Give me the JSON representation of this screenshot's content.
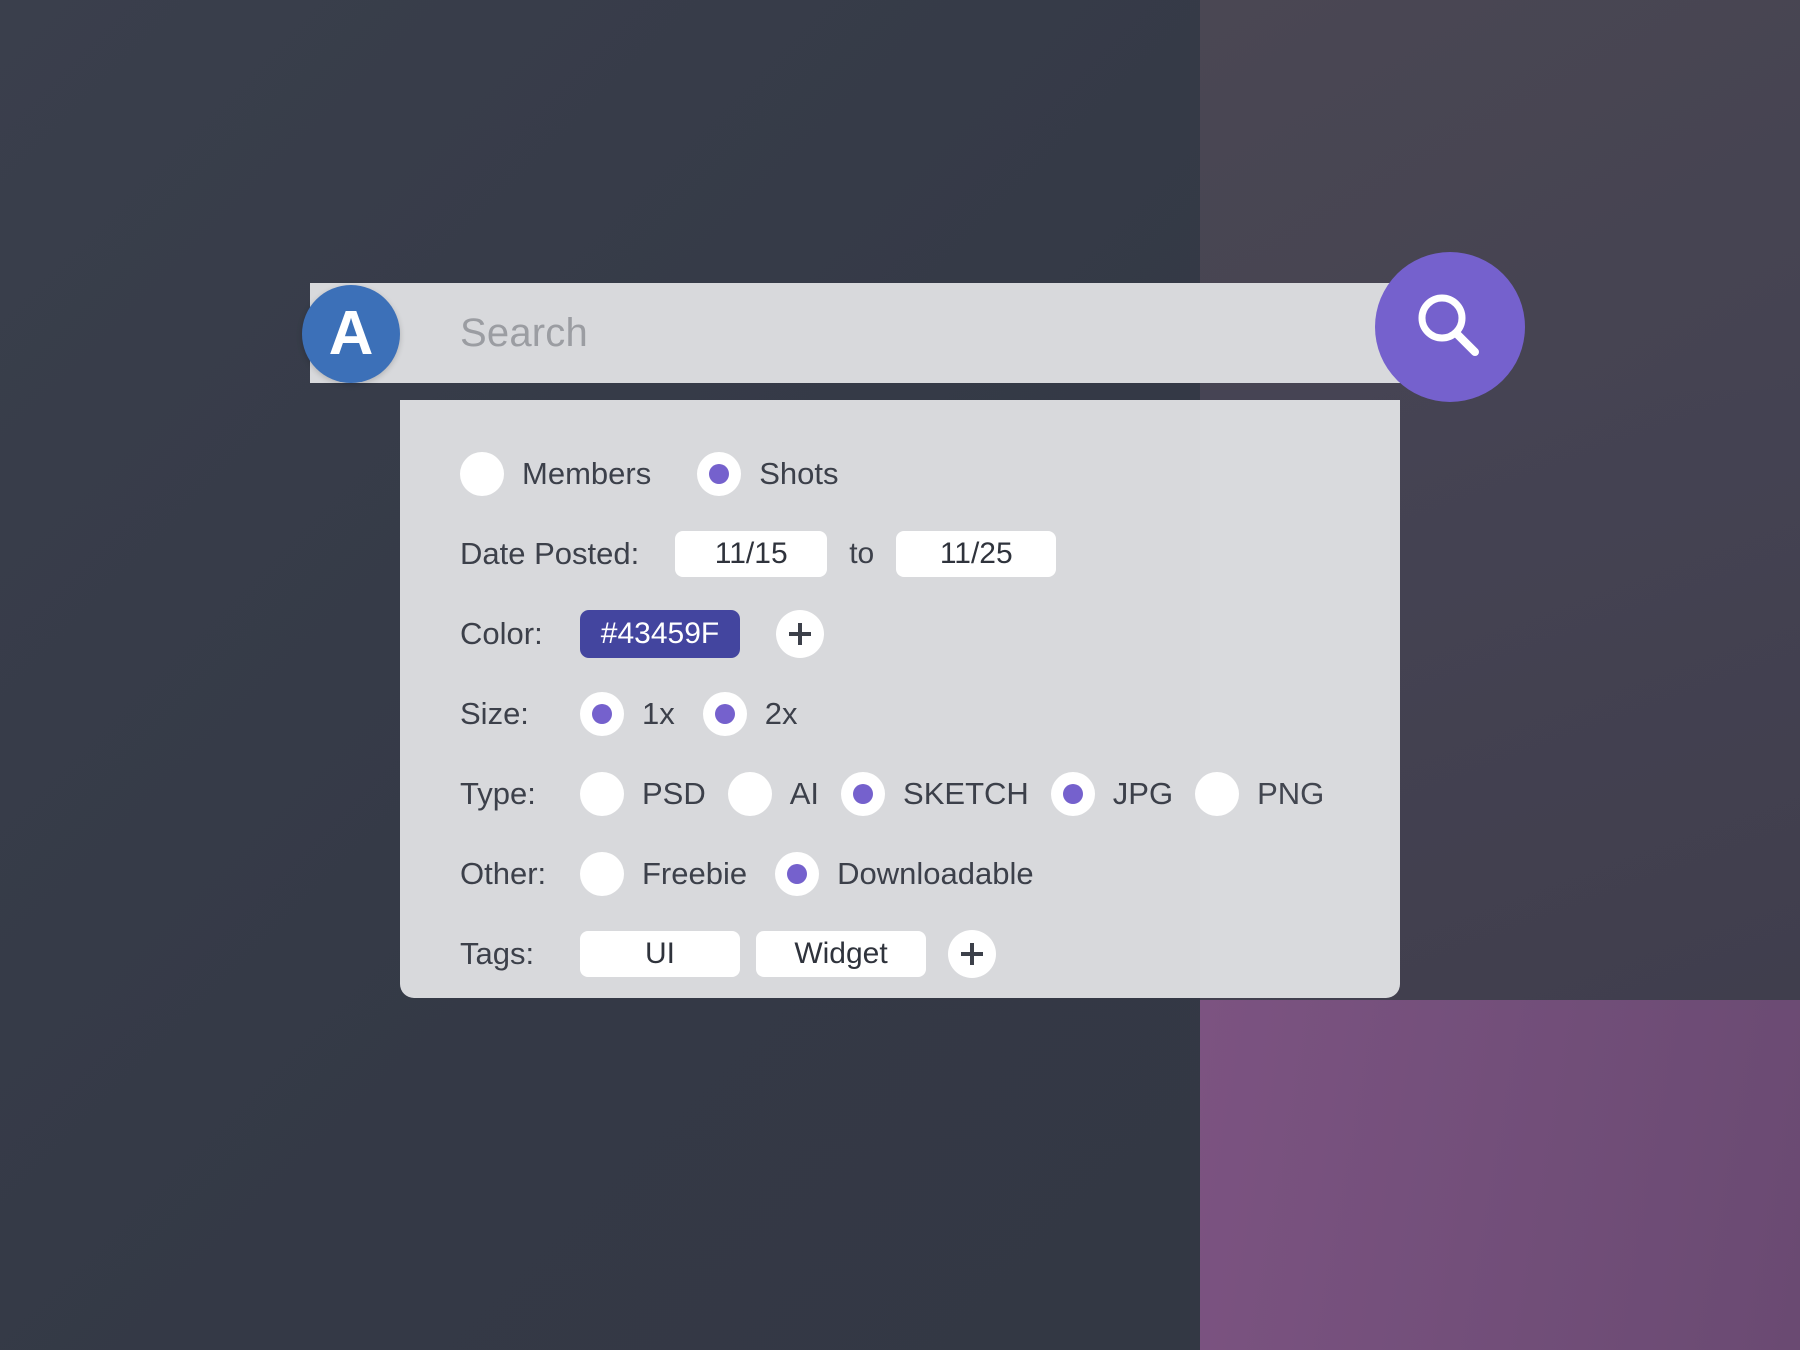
{
  "window": {
    "background_left": "#373c49",
    "background_right_top": "#454352",
    "background_right_bottom": "#75507c"
  },
  "search": {
    "avatar_initial": "A",
    "avatar_color": "#3c70b8",
    "placeholder": "Search",
    "value": "",
    "search_icon": "search-icon",
    "search_button_color": "#7561cd"
  },
  "filters": {
    "scope": {
      "options": [
        {
          "label": "Members",
          "selected": false
        },
        {
          "label": "Shots",
          "selected": true
        }
      ]
    },
    "date_posted": {
      "label": "Date Posted:",
      "from": "11/15",
      "separator": "to",
      "to": "11/25"
    },
    "color": {
      "label": "Color:",
      "swatches": [
        "#43459F"
      ],
      "add_icon": "plus-icon"
    },
    "size": {
      "label": "Size:",
      "options": [
        {
          "label": "1x",
          "selected": true
        },
        {
          "label": "2x",
          "selected": true
        }
      ]
    },
    "type": {
      "label": "Type:",
      "options": [
        {
          "label": "PSD",
          "selected": false
        },
        {
          "label": "AI",
          "selected": false
        },
        {
          "label": "SKETCH",
          "selected": true
        },
        {
          "label": "JPG",
          "selected": true
        },
        {
          "label": "PNG",
          "selected": false
        }
      ]
    },
    "other": {
      "label": "Other:",
      "options": [
        {
          "label": "Freebie",
          "selected": false
        },
        {
          "label": "Downloadable",
          "selected": true
        }
      ]
    },
    "tags": {
      "label": "Tags:",
      "values": [
        "UI",
        "Widget"
      ],
      "add_icon": "plus-icon"
    },
    "accent_color": "#7561cd"
  }
}
